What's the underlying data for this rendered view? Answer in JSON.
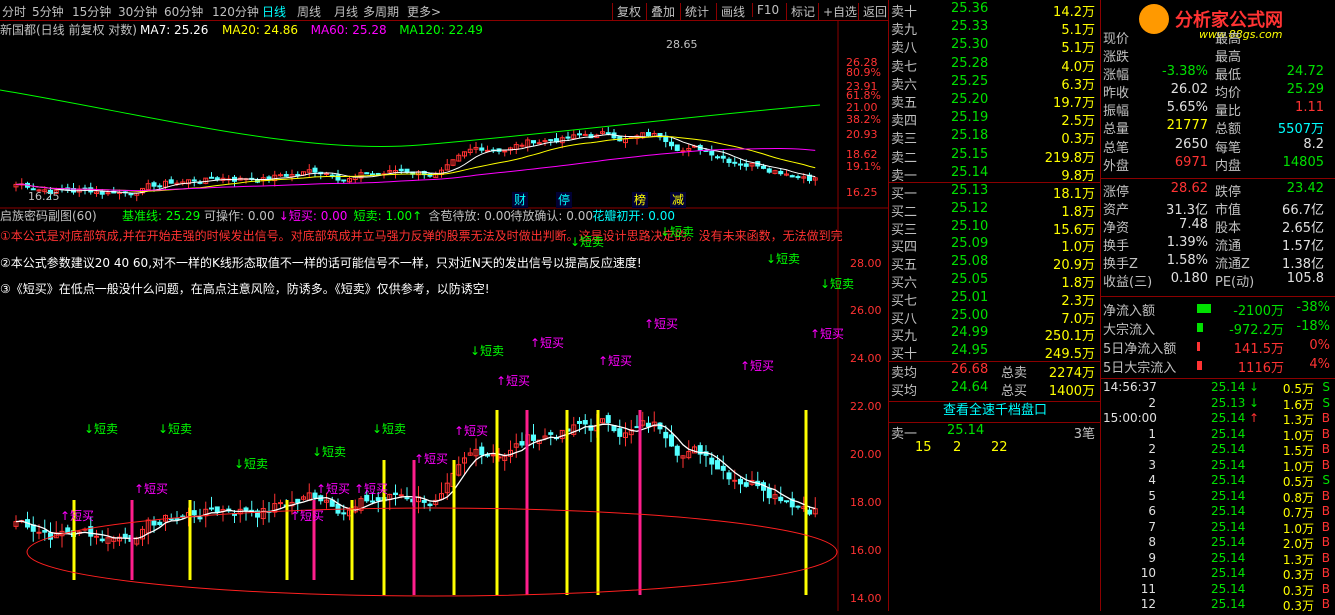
{
  "toolbar": {
    "periods": [
      "分时",
      "5分钟",
      "15分钟",
      "30分钟",
      "60分钟",
      "120分钟",
      "日线",
      "周线",
      "月线",
      "多周期",
      "更多>"
    ],
    "active_period": "日线",
    "buttons": [
      "复权",
      "叠加",
      "统计",
      "画线",
      "F10",
      "标记",
      "+自选",
      "返回"
    ]
  },
  "main_chart": {
    "title": "新国都(日线 前复权 对数)",
    "ma_labels": [
      {
        "text": "MA7: 25.26",
        "color": "#ffffff"
      },
      {
        "text": "MA20: 24.86",
        "color": "#ffff00"
      },
      {
        "text": "MA60: 25.28",
        "color": "#ff00ff"
      },
      {
        "text": "MA120: 22.49",
        "color": "#00ff00"
      }
    ],
    "axis_ticks": [
      "26.28",
      "80.9%",
      "23.91",
      "61.8%",
      "21.00",
      "38.2%",
      "20.93",
      "18.62",
      "19.1%",
      "16.25"
    ],
    "high_label": "28.65",
    "low_label": "16.25",
    "markers": [
      "财",
      "停",
      "榜",
      "减"
    ]
  },
  "sub_chart": {
    "title": "启族密码副图(60)",
    "indicators": [
      {
        "text": "基准线: 25.29",
        "color": "#00ff00"
      },
      {
        "text": "可操作: 0.00",
        "color": "#c0c0c0"
      },
      {
        "text": "↓短买: 0.00",
        "color": "#ff00ff"
      },
      {
        "text": "短卖: 1.00↑",
        "color": "#00ff00"
      },
      {
        "text": "含苞待放: 0.00",
        "color": "#c0c0c0"
      },
      {
        "text": "待放确认: 0.00",
        "color": "#c0c0c0"
      },
      {
        "text": "花瓣初开: 0.00",
        "color": "#00ffff"
      }
    ],
    "notes": [
      "①本公式是对底部筑成,并在开始走强的时候发出信号。对底部筑成并立马强力反弹的股票无法及时做出判断。这是设计思路决定的。没有未来函数，无法做到完",
      "②本公式参数建议20 40 60,对不一样的K线形态取值不一样的话可能信号不一样，只对近N天的发出信号以提高反应速度!",
      "③《短买》在低点一般没什么问题，在高点注意风险，防诱多。《短卖》仅供参考，以防诱空!"
    ],
    "axis_ticks": [
      "28.00",
      "26.00",
      "24.00",
      "22.00",
      "20.00",
      "18.00",
      "16.00",
      "14.00"
    ],
    "sell_label": "↓短卖",
    "buy_label": "↑短买"
  },
  "order_book": {
    "asks": [
      {
        "label": "卖十",
        "price": "25.36",
        "vol": "14.2万"
      },
      {
        "label": "卖九",
        "price": "25.33",
        "vol": "5.1万"
      },
      {
        "label": "卖八",
        "price": "25.30",
        "vol": "5.1万"
      },
      {
        "label": "卖七",
        "price": "25.28",
        "vol": "4.0万"
      },
      {
        "label": "卖六",
        "price": "25.25",
        "vol": "6.3万"
      },
      {
        "label": "卖五",
        "price": "25.20",
        "vol": "19.7万"
      },
      {
        "label": "卖四",
        "price": "25.19",
        "vol": "2.5万"
      },
      {
        "label": "卖三",
        "price": "25.18",
        "vol": "0.3万"
      },
      {
        "label": "卖二",
        "price": "25.15",
        "vol": "219.8万"
      },
      {
        "label": "卖一",
        "price": "25.14",
        "vol": "9.8万"
      }
    ],
    "bids": [
      {
        "label": "买一",
        "price": "25.13",
        "vol": "18.1万"
      },
      {
        "label": "买二",
        "price": "25.12",
        "vol": "1.8万"
      },
      {
        "label": "买三",
        "price": "25.10",
        "vol": "15.6万"
      },
      {
        "label": "买四",
        "price": "25.09",
        "vol": "1.0万"
      },
      {
        "label": "买五",
        "price": "25.08",
        "vol": "20.9万"
      },
      {
        "label": "买六",
        "price": "25.05",
        "vol": "1.8万"
      },
      {
        "label": "买七",
        "price": "25.01",
        "vol": "2.3万"
      },
      {
        "label": "买八",
        "price": "25.00",
        "vol": "7.0万"
      },
      {
        "label": "买九",
        "price": "24.99",
        "vol": "250.1万"
      },
      {
        "label": "买十",
        "price": "24.95",
        "vol": "249.5万"
      }
    ],
    "avg_sell": {
      "label": "卖均",
      "price": "26.68",
      "total_label": "总卖",
      "total": "2274万"
    },
    "avg_buy": {
      "label": "买均",
      "price": "24.64",
      "total_label": "总买",
      "total": "1400万"
    },
    "view_button": "查看全速千档盘口",
    "level1": {
      "label": "卖一",
      "price": "25.14",
      "count": "3笔"
    },
    "level1_queue": [
      "15",
      "2",
      "22"
    ]
  },
  "stats": {
    "logo": "分析家公式网",
    "logo_url": "www.88gs.com",
    "rows": [
      {
        "l1": "现价",
        "v1": "",
        "l2": "最高",
        "v2": ""
      },
      {
        "l1": "涨跌",
        "v1": "",
        "l2": "最高",
        "v2": ""
      },
      {
        "l1": "涨幅",
        "v1": "-3.38%",
        "l2": "最低",
        "v2": "24.72"
      },
      {
        "l1": "昨收",
        "v1": "26.02",
        "l2": "均价",
        "v2": "25.29"
      },
      {
        "l1": "振幅",
        "v1": "5.65%",
        "l2": "量比",
        "v2": "1.11"
      },
      {
        "l1": "总量",
        "v1": "21777",
        "l2": "总额",
        "v2": "5507万"
      },
      {
        "l1": "总笔",
        "v1": "2650",
        "l2": "每笔",
        "v2": "8.2"
      },
      {
        "l1": "外盘",
        "v1": "6971",
        "l2": "内盘",
        "v2": "14805"
      },
      {
        "l1": "涨停",
        "v1": "28.62",
        "l2": "跌停",
        "v2": "23.42"
      },
      {
        "l1": "资产",
        "v1": "31.3亿",
        "l2": "市值",
        "v2": "66.7亿"
      },
      {
        "l1": "净资",
        "v1": "7.48",
        "l2": "股本",
        "v2": "2.65亿"
      },
      {
        "l1": "换手",
        "v1": "1.39%",
        "l2": "流通",
        "v2": "1.57亿"
      },
      {
        "l1": "换手Z",
        "v1": "1.58%",
        "l2": "流通Z",
        "v2": "1.38亿"
      },
      {
        "l1": "收益(三)",
        "v1": "0.180",
        "l2": "PE(动)",
        "v2": "105.8"
      }
    ],
    "flows": [
      {
        "label": "净流入额",
        "value": "-2100万",
        "pct": "-38%",
        "color": "#00e000",
        "bar": 0.35
      },
      {
        "label": "大宗流入",
        "value": "-972.2万",
        "pct": "-18%",
        "color": "#00e000",
        "bar": 0.15
      },
      {
        "label": "5日净流入额",
        "value": "141.5万",
        "pct": "0%",
        "color": "#ff3333",
        "bar": 0.08
      },
      {
        "label": "5日大宗流入",
        "value": "1116万",
        "pct": "4%",
        "color": "#ff3333",
        "bar": 0.12
      }
    ],
    "ticks": [
      {
        "t": "14:56:37",
        "p": "25.14",
        "arrow": "↓",
        "v": "0.5万",
        "s": "S"
      },
      {
        "t": "2",
        "p": "25.13",
        "arrow": "↓",
        "v": "1.6万",
        "s": "S"
      },
      {
        "t": "15:00:00",
        "p": "25.14",
        "arrow": "↑",
        "v": "1.3万",
        "s": "B"
      },
      {
        "t": "1",
        "p": "25.14",
        "arrow": "",
        "v": "1.0万",
        "s": "B"
      },
      {
        "t": "2",
        "p": "25.14",
        "arrow": "",
        "v": "1.5万",
        "s": "B"
      },
      {
        "t": "3",
        "p": "25.14",
        "arrow": "",
        "v": "1.0万",
        "s": "B"
      },
      {
        "t": "4",
        "p": "25.14",
        "arrow": "",
        "v": "0.5万",
        "s": "S"
      },
      {
        "t": "5",
        "p": "25.14",
        "arrow": "",
        "v": "0.8万",
        "s": "B"
      },
      {
        "t": "6",
        "p": "25.14",
        "arrow": "",
        "v": "0.7万",
        "s": "B"
      },
      {
        "t": "7",
        "p": "25.14",
        "arrow": "",
        "v": "1.0万",
        "s": "B"
      },
      {
        "t": "8",
        "p": "25.14",
        "arrow": "",
        "v": "2.0万",
        "s": "B"
      },
      {
        "t": "9",
        "p": "25.14",
        "arrow": "",
        "v": "1.3万",
        "s": "B"
      },
      {
        "t": "10",
        "p": "25.14",
        "arrow": "",
        "v": "0.3万",
        "s": "B"
      },
      {
        "t": "11",
        "p": "25.14",
        "arrow": "",
        "v": "0.3万",
        "s": "B"
      },
      {
        "t": "12",
        "p": "25.14",
        "arrow": "",
        "v": "0.3万",
        "s": "B"
      }
    ]
  }
}
